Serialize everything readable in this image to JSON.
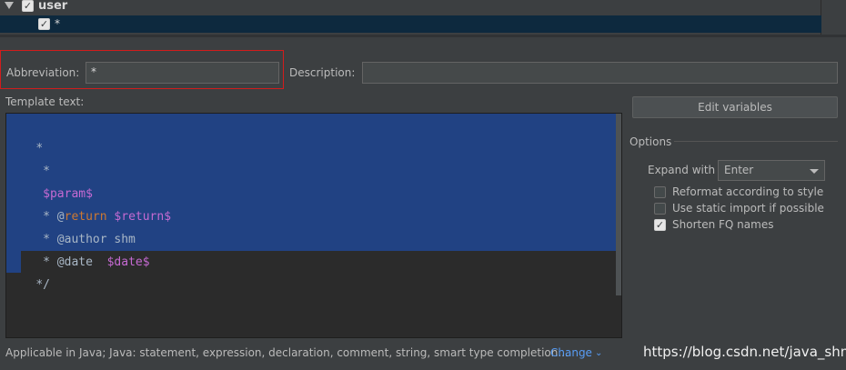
{
  "tree": {
    "group_label": "user",
    "group_checked": true,
    "item_label": "*",
    "item_checked": true
  },
  "abbreviation": {
    "label": "Abbreviation:",
    "value": "*"
  },
  "description": {
    "label": "Description:",
    "value": ""
  },
  "template": {
    "label": "Template text:",
    "lines": [
      {
        "text": "*"
      },
      {
        "text": " *"
      },
      {
        "text": " $param$"
      },
      {
        "prefix": " * @",
        "keyword": "return",
        "space": " ",
        "var": "$return$"
      },
      {
        "text": " * @author shm"
      },
      {
        "prefix": " * @date  ",
        "var": "$date$"
      },
      {
        "text": "*/"
      }
    ]
  },
  "edit_variables_button": "Edit variables",
  "options": {
    "title": "Options",
    "expand_with_label": "Expand with",
    "expand_with_value": "Enter",
    "reformat": {
      "label": "Reformat according to style",
      "checked": false
    },
    "static_import": {
      "label": "Use static import if possible",
      "checked": false
    },
    "shorten_fq": {
      "label": "Shorten FQ names",
      "checked": true
    }
  },
  "footer": {
    "applicable": "Applicable in Java; Java: statement, expression, declaration, comment, string, smart type completion...",
    "change_link": "Change",
    "watermark": "https://blog.csdn.net/java_shm"
  },
  "colors": {
    "selection": "#214283",
    "link": "#589df6",
    "highlight_border": "#d21c1c"
  }
}
